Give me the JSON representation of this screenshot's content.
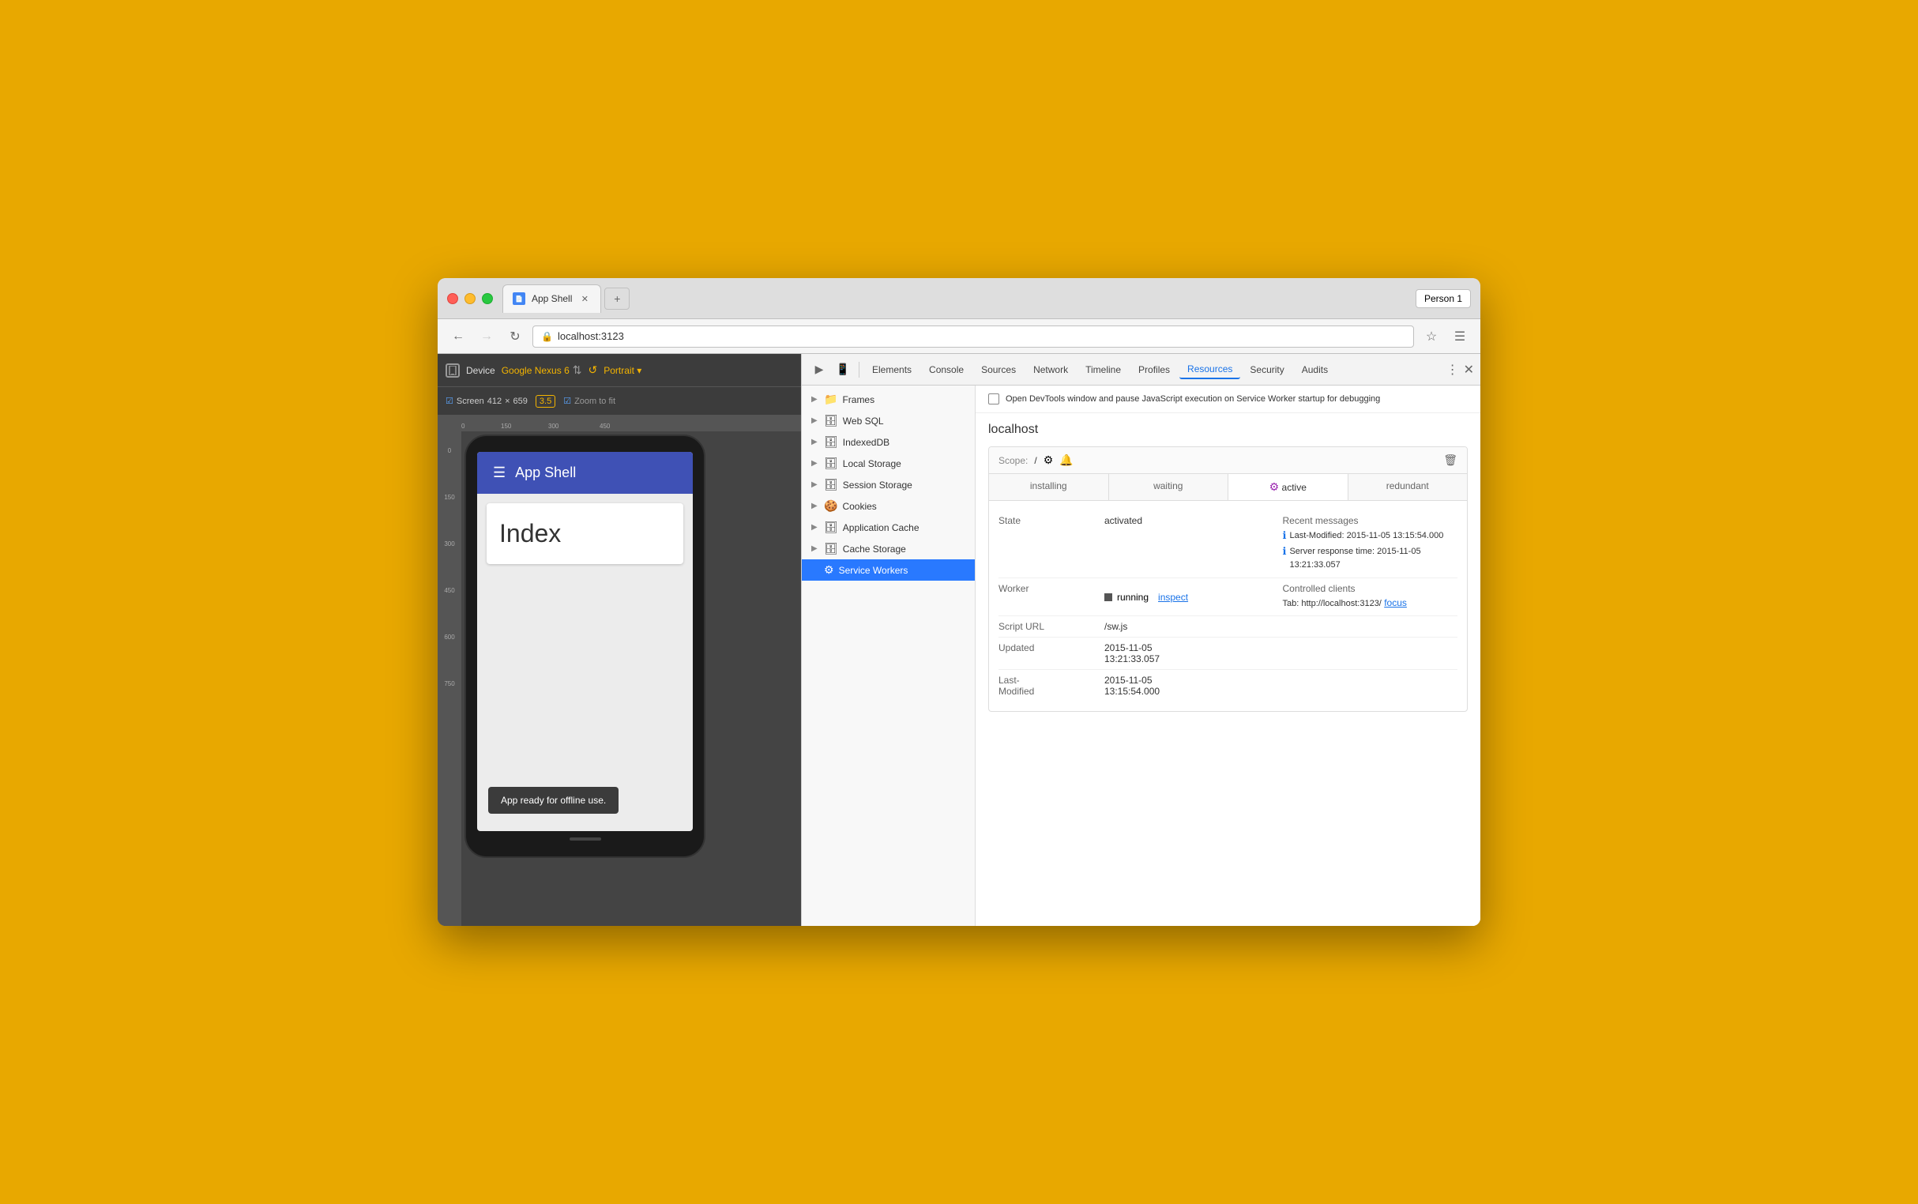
{
  "browser": {
    "title": "App Shell",
    "tab_label": "App Shell",
    "address": "localhost:3123",
    "person_label": "Person 1"
  },
  "devtools_tabs": {
    "tabs": [
      "Elements",
      "Console",
      "Sources",
      "Network",
      "Timeline",
      "Profiles",
      "Resources",
      "Security",
      "Audits"
    ],
    "active_tab": "Resources"
  },
  "device_toolbar": {
    "device_label": "Device",
    "device_name": "Google Nexus 6",
    "orientation": "Portrait ▾",
    "screen_label": "Screen",
    "width": "412",
    "cross": "×",
    "height": "659",
    "dpr": "3.5",
    "zoom_label": "Zoom to fit"
  },
  "resources_sidebar": {
    "items": [
      {
        "label": "Frames",
        "icon": "📁",
        "arrow": "▶",
        "selected": false
      },
      {
        "label": "Web SQL",
        "icon": "🗄",
        "arrow": "▶",
        "selected": false
      },
      {
        "label": "IndexedDB",
        "icon": "🗄",
        "arrow": "▶",
        "selected": false
      },
      {
        "label": "Local Storage",
        "icon": "🗄",
        "arrow": "▶",
        "selected": false
      },
      {
        "label": "Session Storage",
        "icon": "🗄",
        "arrow": "▶",
        "selected": false
      },
      {
        "label": "Cookies",
        "icon": "🍪",
        "arrow": "▶",
        "selected": false
      },
      {
        "label": "Application Cache",
        "icon": "🗄",
        "arrow": "▶",
        "selected": false
      },
      {
        "label": "Cache Storage",
        "icon": "🗄",
        "arrow": "▶",
        "selected": false
      },
      {
        "label": "Service Workers",
        "icon": "⚙",
        "arrow": "",
        "selected": true
      }
    ]
  },
  "service_worker": {
    "notification_text": "Open DevTools window and pause JavaScript execution on Service Worker startup for debugging",
    "host": "localhost",
    "scope_label": "Scope:",
    "scope_value": "/",
    "tabs": [
      "installing",
      "waiting",
      "active",
      "redundant"
    ],
    "active_tab": "active",
    "state_label": "State",
    "state_value": "activated",
    "worker_label": "Worker",
    "worker_status": "running",
    "inspect_label": "inspect",
    "script_label": "Script URL",
    "script_url": "/sw.js",
    "updated_label": "Updated",
    "updated_value": "2015-11-05\n13:21:33.057",
    "last_modified_label": "Last-\nModified",
    "last_modified_value": "2015-11-05\n13:15:54.000",
    "recent_messages_label": "Recent messages",
    "msg1": "Last-Modified: 2015-11-05 13:15:54.000",
    "msg2": "Server response time: 2015-11-05 13:21:33.057",
    "controlled_label": "Controlled clients",
    "client_text": "Tab: http://localhost:3123/",
    "focus_label": "focus"
  },
  "app": {
    "title": "App Shell",
    "index_text": "Index",
    "snackbar_text": "App ready for offline use."
  }
}
